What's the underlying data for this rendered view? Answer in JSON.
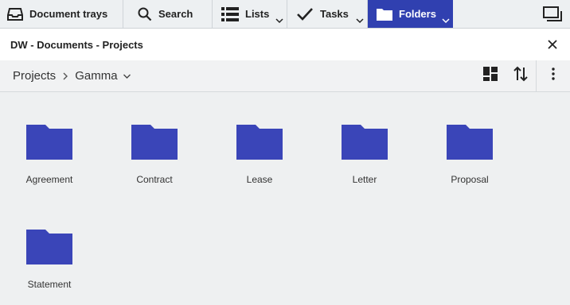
{
  "toolbar": {
    "tabs": [
      {
        "label": "Document trays",
        "icon": "tray-icon",
        "dropdown": false,
        "active": false
      },
      {
        "label": "Search",
        "icon": "search-icon",
        "dropdown": false,
        "active": false
      },
      {
        "label": "Lists",
        "icon": "list-icon",
        "dropdown": true,
        "active": false
      },
      {
        "label": "Tasks",
        "icon": "checkmark-icon",
        "dropdown": true,
        "active": false
      },
      {
        "label": "Folders",
        "icon": "folder-icon",
        "dropdown": true,
        "active": true
      }
    ],
    "window_icon": "window-icon"
  },
  "header": {
    "title": "DW - Documents - Projects",
    "close_icon": "close-icon"
  },
  "breadcrumb": {
    "items": [
      "Projects",
      "Gamma"
    ],
    "separator_icon": "chevron-right-icon",
    "dropdown_icon": "chevron-down-icon"
  },
  "view_tools": {
    "grid_view_icon": "grid-view-icon",
    "sort_icon": "sort-icon",
    "more_icon": "more-vert-icon"
  },
  "folders": [
    {
      "name": "Agreement"
    },
    {
      "name": "Contract"
    },
    {
      "name": "Lease"
    },
    {
      "name": "Letter"
    },
    {
      "name": "Proposal"
    },
    {
      "name": "Statement"
    }
  ],
  "colors": {
    "accent": "#3040b0",
    "folder": "#3a45b8",
    "background": "#eef0f1"
  }
}
